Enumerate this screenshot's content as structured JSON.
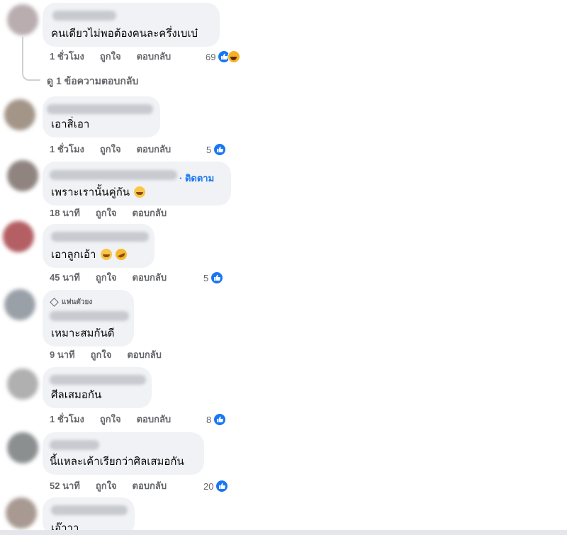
{
  "comments": [
    {
      "text": "คนเดียวไม่พอต้องคนละครึ่งเบเบ๋",
      "time": "1 ชั่วโมง",
      "like_label": "ถูกใจ",
      "reply_label": "ตอบกลับ",
      "reaction_count": "69",
      "reactions": [
        "like-icon",
        "haha-icon"
      ],
      "view_replies": "ดู 1 ข้อความตอบกลับ"
    },
    {
      "text": "เอาสิ่เอา",
      "time": "1 ชั่วโมง",
      "like_label": "ถูกใจ",
      "reply_label": "ตอบกลับ",
      "reaction_count": "5",
      "reactions": [
        "like-icon"
      ]
    },
    {
      "text": "เพราะเรานั้นคู่กัน",
      "follow_label": "· ติดตาม",
      "time": "18 นาที",
      "like_label": "ถูกใจ",
      "reply_label": "ตอบกลับ",
      "emoji": [
        "smile-emoji"
      ]
    },
    {
      "text": "เอาลูกเอ้า",
      "time": "45 นาที",
      "like_label": "ถูกใจ",
      "reply_label": "ตอบกลับ",
      "reaction_count": "5",
      "reactions": [
        "like-icon"
      ],
      "emoji": [
        "smile-emoji",
        "rofl-emoji"
      ]
    },
    {
      "badge": "แฟนตัวยง",
      "text": "เหมาะสมกันดี",
      "time": "9 นาที",
      "like_label": "ถูกใจ",
      "reply_label": "ตอบกลับ"
    },
    {
      "text": "ศีลเสมอกัน",
      "time": "1 ชั่วโมง",
      "like_label": "ถูกใจ",
      "reply_label": "ตอบกลับ",
      "reaction_count": "8",
      "reactions": [
        "like-icon"
      ]
    },
    {
      "text": "นี้แหละเค้าเรียกว่าศิลเสมอกัน",
      "time": "52 นาที",
      "like_label": "ถูกใจ",
      "reply_label": "ตอบกลับ",
      "reaction_count": "20",
      "reactions": [
        "like-icon"
      ]
    },
    {
      "text": "เอ๊าาา"
    }
  ],
  "colors": {
    "bubble": "#f0f2f5",
    "meta": "#65676b",
    "like": "#1877f2"
  }
}
